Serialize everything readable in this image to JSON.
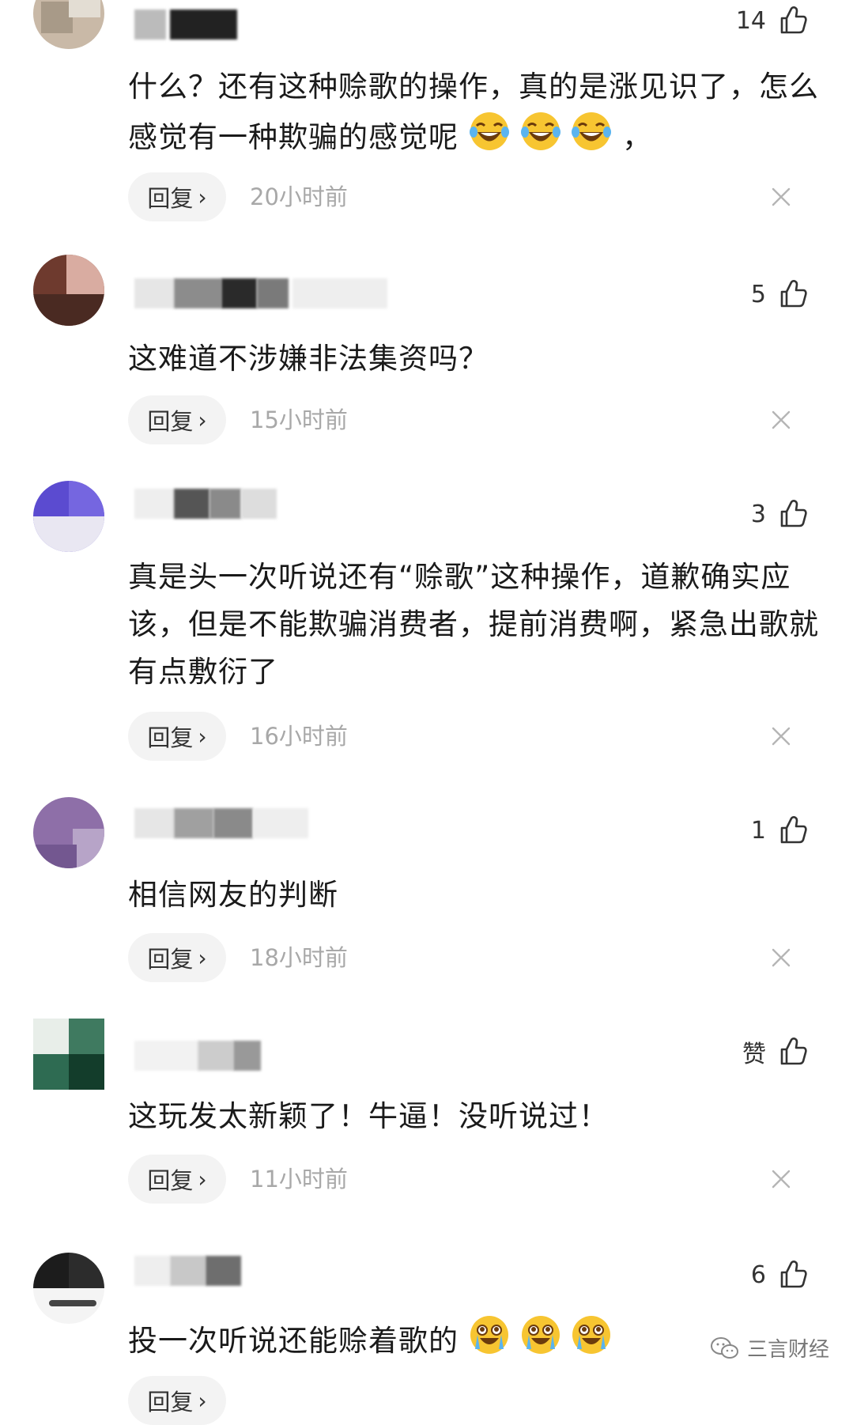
{
  "comments": [
    {
      "likes": "14",
      "text": "什么？还有这种赊歌的操作，真的是涨见识了，怎么感觉有一种欺骗的感觉呢",
      "emoji_suffix": "，",
      "reply": "回复",
      "time": "20小时前"
    },
    {
      "likes": "5",
      "text": "这难道不涉嫌非法集资吗？",
      "reply": "回复",
      "time": "15小时前"
    },
    {
      "likes": "3",
      "text": "真是头一次听说还有“赊歌”这种操作，道歉确实应该，但是不能欺骗消费者，提前消费啊，紧急出歌就有点敷衍了",
      "reply": "回复",
      "time": "16小时前"
    },
    {
      "likes": "1",
      "text": "相信网友的判断",
      "reply": "回复",
      "time": "18小时前"
    },
    {
      "likes": "赞",
      "text": "这玩发太新颖了！牛逼！没听说过！",
      "reply": "回复",
      "time": "11小时前"
    },
    {
      "likes": "6",
      "text": "投一次听说还能赊着歌的",
      "reply": "回复",
      "time": ""
    }
  ],
  "watermark": {
    "text": "三言财经",
    "icon": "wechat-icon"
  },
  "colors": {
    "time_gray": "#a8a8a8",
    "pill_bg": "#f3f3f3",
    "emoji_yellow": "#f7c531"
  }
}
